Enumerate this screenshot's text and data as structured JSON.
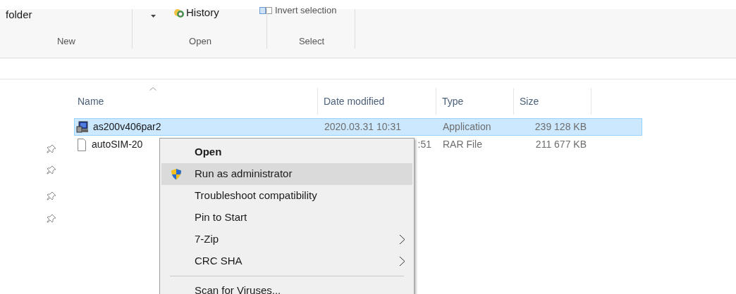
{
  "ribbon": {
    "top_items": [
      {
        "kind": "text",
        "label": "folder"
      },
      {
        "kind": "history",
        "label": "History"
      },
      {
        "kind": "checkbox",
        "label": "Invert selection"
      }
    ],
    "groups": [
      "New",
      "Open",
      "Select"
    ]
  },
  "file_list": {
    "columns": [
      "Name",
      "Date modified",
      "Type",
      "Size"
    ],
    "rows": [
      {
        "kind": "application",
        "name": "as200v406par2",
        "date": "2020.03.31 10:31",
        "type": "Application",
        "size": "239 128 KB",
        "selected": true
      },
      {
        "kind": "file",
        "name": "autoSIM-20",
        "date": ":51",
        "type": "RAR File",
        "size": "211 677 KB",
        "selected": false
      }
    ]
  },
  "context_menu": {
    "items": [
      {
        "kind": "default",
        "label": "Open",
        "hovered": false
      },
      {
        "kind": "shield",
        "label": "Run as administrator",
        "hovered": true
      },
      {
        "kind": "plain",
        "label": "Troubleshoot compatibility",
        "hovered": false
      },
      {
        "kind": "plain",
        "label": "Pin to Start",
        "hovered": false
      },
      {
        "kind": "submenu",
        "label": "7-Zip",
        "hovered": false
      },
      {
        "kind": "submenu",
        "label": "CRC SHA",
        "hovered": false
      },
      {
        "kind": "separator"
      },
      {
        "kind": "plain",
        "label": "Scan for Viruses...",
        "hovered": false
      }
    ]
  }
}
